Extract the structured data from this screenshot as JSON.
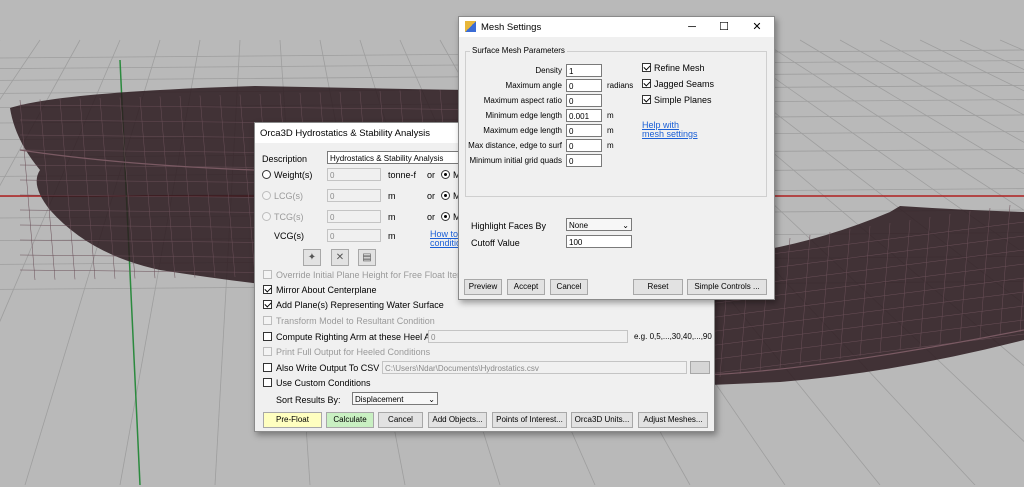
{
  "hydro": {
    "title": "Orca3D Hydrostatics & Stability Analysis",
    "description_label": "Description",
    "description_value": "Hydrostatics & Stability Analysis",
    "weight": {
      "label": "Weight(s)",
      "value": "0",
      "unit": "tonne-f",
      "or": "or",
      "m_label": "M"
    },
    "lcg": {
      "label": "LCG(s)",
      "value": "0",
      "unit": "m",
      "or": "or",
      "m_label": "M"
    },
    "tcg": {
      "label": "TCG(s)",
      "value": "0",
      "unit": "m",
      "or": "or",
      "m_label": "M"
    },
    "vcg": {
      "label": "VCG(s)",
      "value": "0",
      "unit": "m"
    },
    "help_link_1": "How to e",
    "help_link_2": "conditio",
    "override": "Override Initial Plane Height for Free Float Iteration",
    "mirror": "Mirror About Centerplane",
    "add_planes": "Add Plane(s) Representing Water Surface",
    "transform": "Transform Model to Resultant Condition",
    "righting": "Compute Righting Arm at these Heel Angles",
    "righting_value": "0",
    "righting_example": "e.g. 0,5,...,30,40,...,90",
    "print_full": "Print Full Output for Heeled Conditions",
    "csv": "Also Write Output To CSV File",
    "csv_path": "C:\\Users\\Ndar\\Documents\\Hydrostatics.csv",
    "custom": "Use Custom Conditions",
    "sort_label": "Sort Results By:",
    "sort_value": "Displacement",
    "buttons": {
      "prefloat": "Pre-Float",
      "calculate": "Calculate",
      "cancel": "Cancel",
      "add_objects": "Add Objects...",
      "points": "Points of Interest...",
      "units": "Orca3D Units...",
      "adjust": "Adjust Meshes..."
    }
  },
  "mesh": {
    "title": "Mesh Settings",
    "group_title": "Surface Mesh Parameters",
    "params": [
      {
        "label": "Density",
        "value": "1",
        "unit": ""
      },
      {
        "label": "Maximum angle",
        "value": "0",
        "unit": "radians"
      },
      {
        "label": "Maximum aspect ratio",
        "value": "0",
        "unit": ""
      },
      {
        "label": "Minimum edge length",
        "value": "0.001",
        "unit": "m"
      },
      {
        "label": "Maximum edge length",
        "value": "0",
        "unit": "m"
      },
      {
        "label": "Max distance, edge to surf",
        "value": "0",
        "unit": "m"
      },
      {
        "label": "Minimum initial grid quads",
        "value": "0",
        "unit": ""
      }
    ],
    "refine": "Refine Mesh",
    "jagged": "Jagged Seams",
    "simple_planes": "Simple Planes",
    "help_1": "Help with",
    "help_2": "mesh settings",
    "highlight_label": "Highlight Faces By",
    "highlight_value": "None",
    "cutoff_label": "Cutoff Value",
    "cutoff_value": "100",
    "buttons": {
      "preview": "Preview",
      "accept": "Accept",
      "cancel": "Cancel",
      "reset": "Reset",
      "simple": "Simple Controls ..."
    }
  },
  "colors": {
    "viewport_bg": "#b9b9b9",
    "grid": "#9e9e9e",
    "hull": "#3a1d24",
    "axis_red": "#b02020",
    "axis_green": "#2b8a3e",
    "highlight_circle": "#d0161c",
    "prefloat_bg": "#ffffc0",
    "calculate_bg": "#c9f0c2"
  }
}
